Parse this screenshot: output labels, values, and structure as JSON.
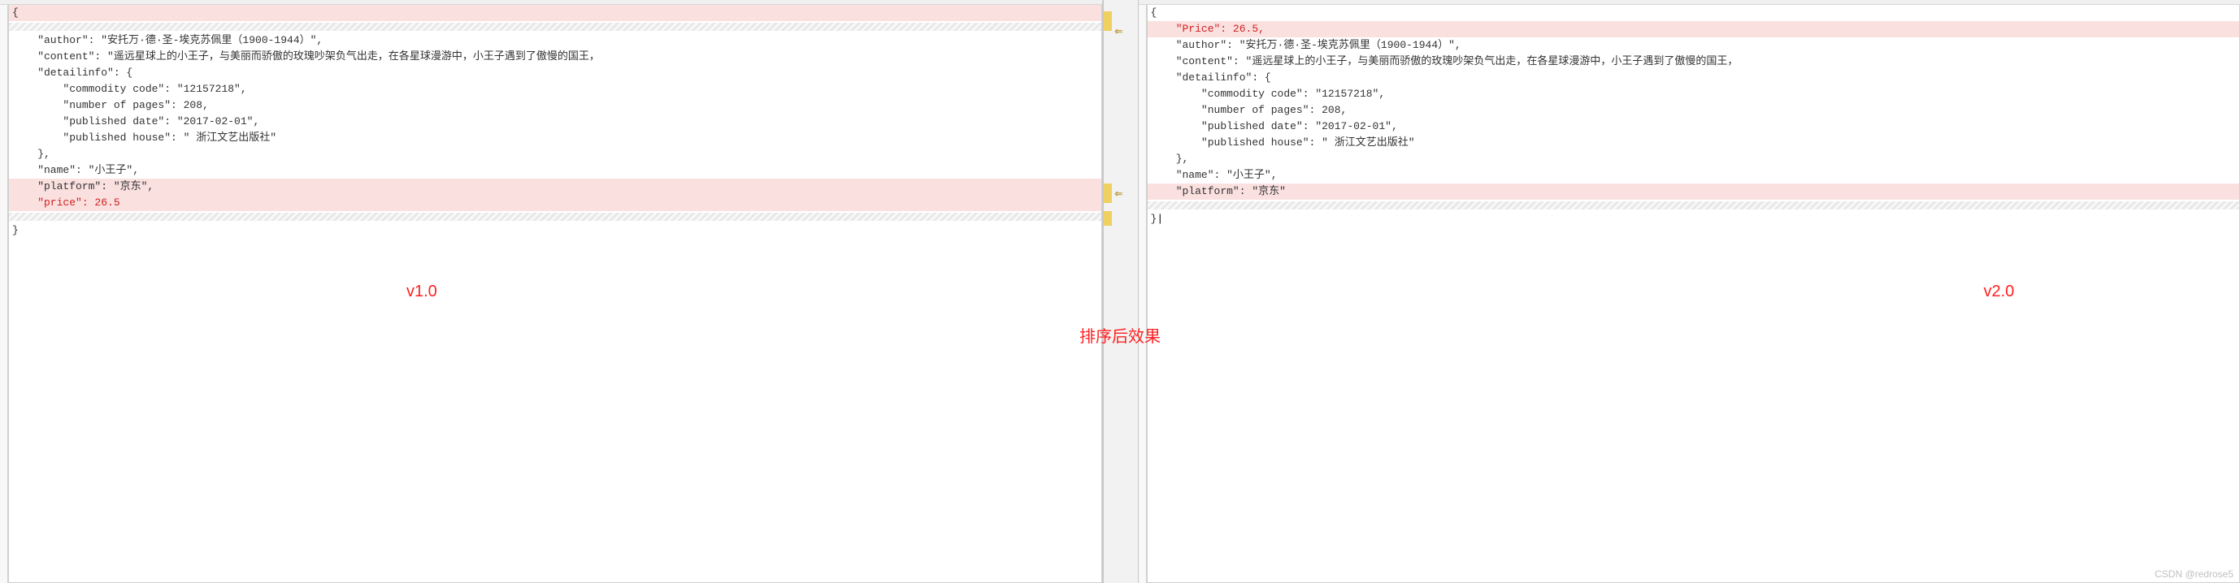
{
  "left": {
    "label": "v1.0",
    "lines": [
      {
        "text": "{",
        "highlight": "pink"
      },
      {
        "text": "",
        "hatch": true
      },
      {
        "text": "    \"author\": \"安托万·德·圣-埃克苏佩里（1900-1944）\","
      },
      {
        "text": "    \"content\": \"遥远星球上的小王子，与美丽而骄傲的玫瑰吵架负气出走，在各星球漫游中，小王子遇到了傲慢的国王，"
      },
      {
        "text": "    \"detailinfo\": {"
      },
      {
        "text": "        \"commodity code\": \"12157218\","
      },
      {
        "text": "        \"number of pages\": 208,"
      },
      {
        "text": "        \"published date\": \"2017-02-01\","
      },
      {
        "text": "        \"published house\": \" 浙江文艺出版社\""
      },
      {
        "text": "    },"
      },
      {
        "text": "    \"name\": \"小王子\","
      },
      {
        "text": "    \"platform\": \"京东\",",
        "highlight": "pink"
      },
      {
        "text": "    \"price\": 26.5",
        "highlight": "pink",
        "redText": true
      },
      {
        "text": "",
        "hatch": true
      },
      {
        "text": "}"
      }
    ]
  },
  "right": {
    "label": "v2.0",
    "lines": [
      {
        "text": "{"
      },
      {
        "text": "    \"Price\": 26.5,",
        "highlight": "pink",
        "redText": true
      },
      {
        "text": "    \"author\": \"安托万·德·圣-埃克苏佩里（1900-1944）\","
      },
      {
        "text": "    \"content\": \"遥远星球上的小王子，与美丽而骄傲的玫瑰吵架负气出走，在各星球漫游中，小王子遇到了傲慢的国王，"
      },
      {
        "text": "    \"detailinfo\": {"
      },
      {
        "text": "        \"commodity code\": \"12157218\","
      },
      {
        "text": "        \"number of pages\": 208,"
      },
      {
        "text": "        \"published date\": \"2017-02-01\","
      },
      {
        "text": "        \"published house\": \" 浙江文艺出版社\""
      },
      {
        "text": "    },"
      },
      {
        "text": "    \"name\": \"小王子\","
      },
      {
        "text": "    \"platform\": \"京东\"",
        "highlight": "pink"
      },
      {
        "text": "",
        "hatch": true
      },
      {
        "text": "}",
        "cursor": true
      }
    ]
  },
  "centerLabel": "排序后效果",
  "watermark": "CSDN @redrose5",
  "arrows": {
    "glyph": "⇐"
  }
}
